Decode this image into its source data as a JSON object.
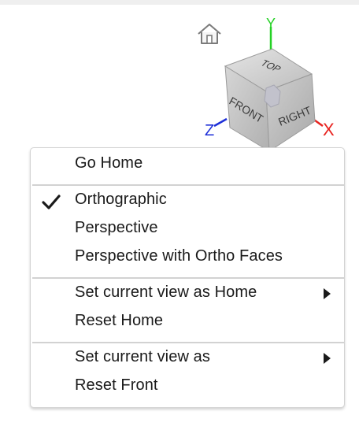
{
  "context_menu": {
    "items": [
      {
        "label": "Go Home",
        "checked": false,
        "has_submenu": false
      },
      {
        "label": "Orthographic",
        "checked": true,
        "has_submenu": false
      },
      {
        "label": "Perspective",
        "checked": false,
        "has_submenu": false
      },
      {
        "label": "Perspective with Ortho Faces",
        "checked": false,
        "has_submenu": false
      },
      {
        "label": "Set current view as Home",
        "checked": false,
        "has_submenu": true
      },
      {
        "label": "Reset Home",
        "checked": false,
        "has_submenu": false
      },
      {
        "label": "Set current view as",
        "checked": false,
        "has_submenu": true
      },
      {
        "label": "Reset Front",
        "checked": false,
        "has_submenu": false
      }
    ]
  },
  "viewcube": {
    "faces": {
      "top": "TOP",
      "front": "FRONT",
      "right": "RIGHT"
    },
    "axes": {
      "x": "X",
      "y": "Y",
      "z": "Z"
    },
    "colors": {
      "x": "#e8231f",
      "y": "#25d125",
      "z": "#1d2fd8"
    }
  },
  "icons": {
    "home": "home-icon",
    "check": "checkmark-icon",
    "submenu": "submenu-arrow-icon"
  }
}
